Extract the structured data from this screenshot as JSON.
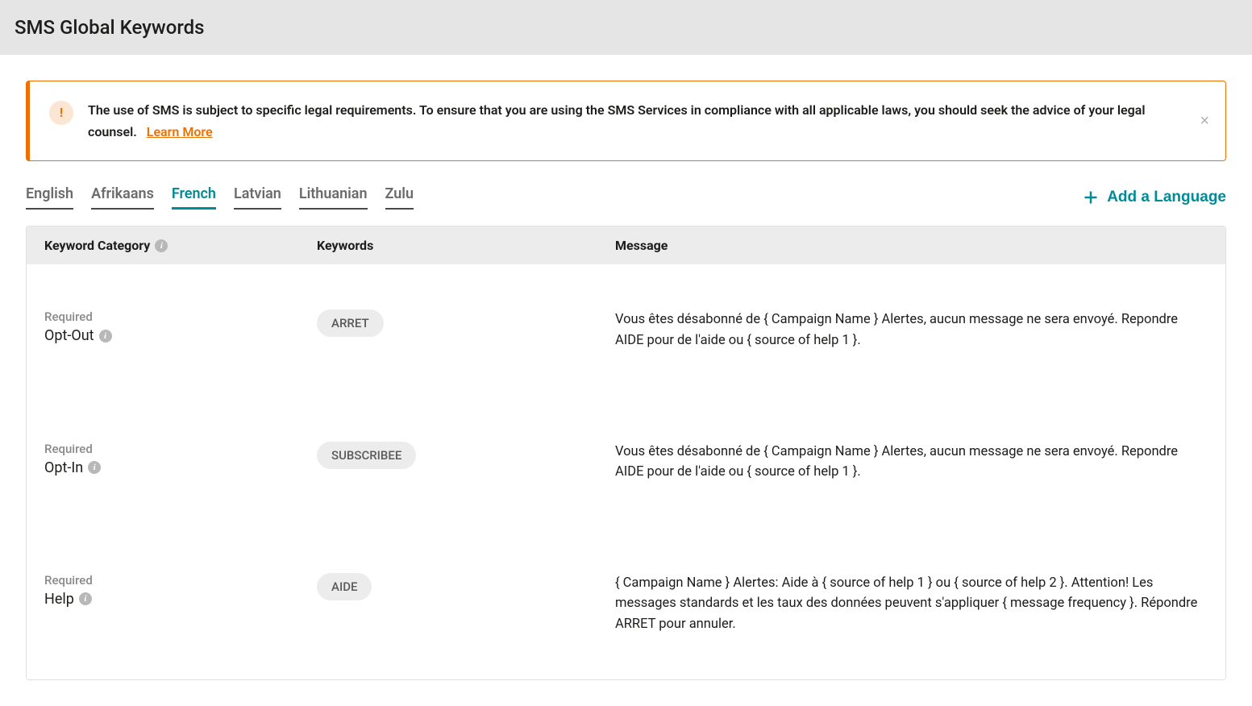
{
  "header": {
    "title": "SMS Global Keywords"
  },
  "alert": {
    "text": "The use of SMS is subject to specific legal requirements. To ensure that you are using the SMS Services in compliance with all applicable laws, you should seek the advice of your legal counsel.",
    "link_label": "Learn More"
  },
  "tabs": [
    {
      "label": "English",
      "active": false
    },
    {
      "label": "Afrikaans",
      "active": false
    },
    {
      "label": "French",
      "active": true
    },
    {
      "label": "Latvian",
      "active": false
    },
    {
      "label": "Lithuanian",
      "active": false
    },
    {
      "label": "Zulu",
      "active": false
    }
  ],
  "add_language_label": "Add a Language",
  "table": {
    "headers": {
      "category": "Keyword Category",
      "keywords": "Keywords",
      "message": "Message"
    },
    "rows": [
      {
        "required_label": "Required",
        "category": "Opt-Out",
        "keyword": "ARRET",
        "message": "Vous êtes désabonné de { Campaign Name } Alertes, aucun message ne sera envoyé. Repondre AIDE pour de l'aide ou { source of help 1 }."
      },
      {
        "required_label": "Required",
        "category": "Opt-In",
        "keyword": "SUBSCRIBEE",
        "message": "Vous êtes désabonné de { Campaign Name } Alertes, aucun message ne sera envoyé. Repondre AIDE pour de l'aide ou { source of help 1 }."
      },
      {
        "required_label": "Required",
        "category": "Help",
        "keyword": "AIDE",
        "message": "{ Campaign Name } Alertes: Aide à { source of help 1 } ou { source of help 2 }. Attention! Les messages standards et les taux des données peuvent s'appliquer { message frequency }. Répondre ARRET pour annuler."
      }
    ]
  }
}
